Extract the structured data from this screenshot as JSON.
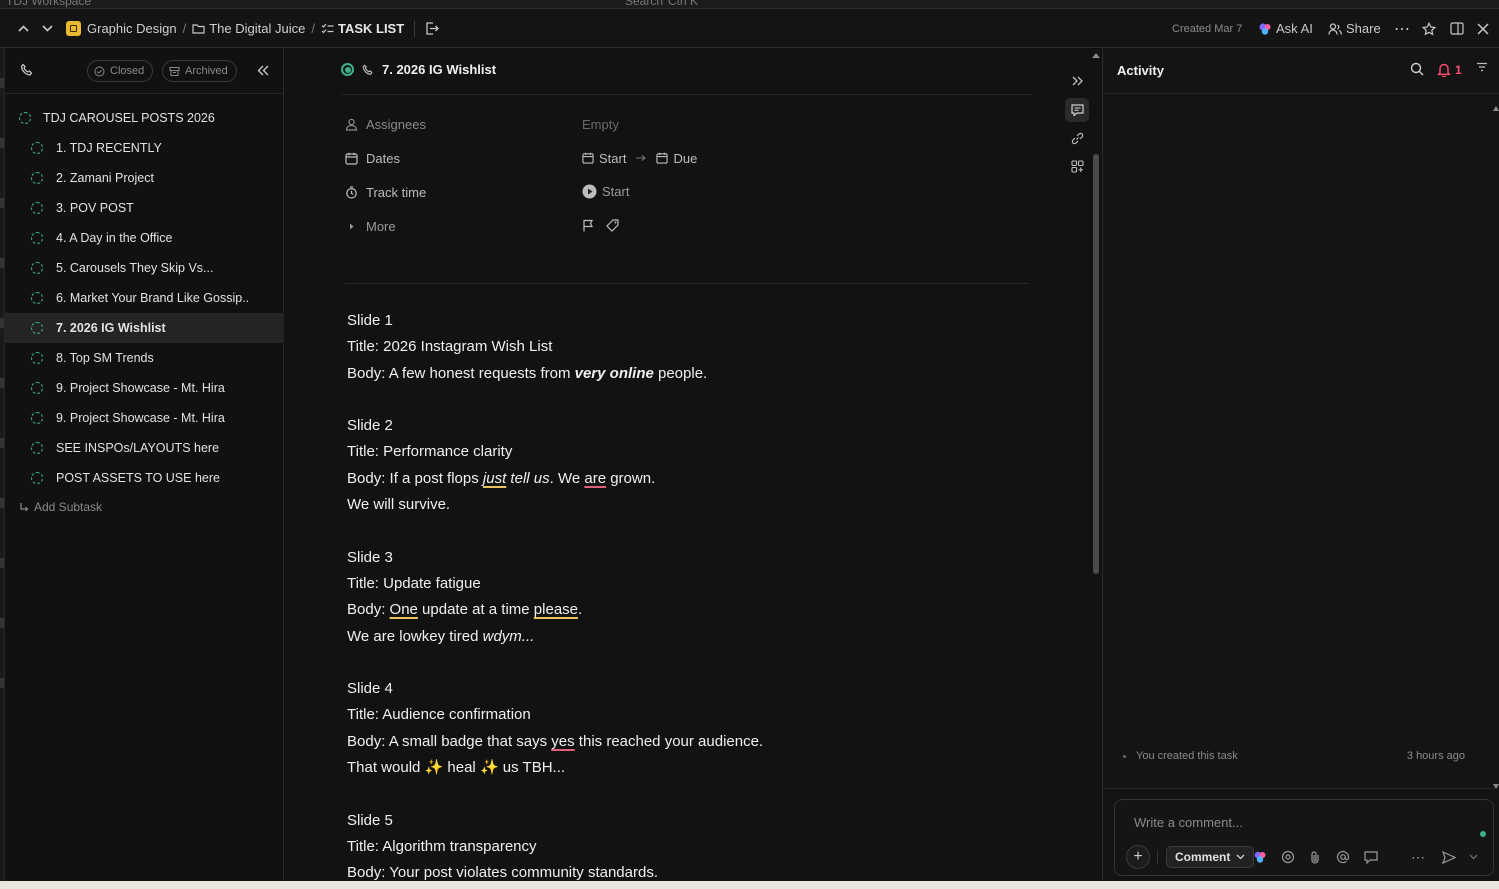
{
  "topstrip": {
    "workspace": "TDJ Workspace",
    "search": "Search",
    "shortcut": "Ctrl K"
  },
  "header": {
    "breadcrumb": [
      "Graphic Design",
      "The Digital Juice",
      "TASK LIST"
    ],
    "created": "Created Mar 7",
    "ask_ai": "Ask AI",
    "share": "Share"
  },
  "left_panel": {
    "filters": {
      "closed": "Closed",
      "archived": "Archived"
    },
    "parent_task": "TDJ CAROUSEL POSTS 2026",
    "subtasks": [
      {
        "label": "1. TDJ RECENTLY"
      },
      {
        "label": "2. Zamani Project"
      },
      {
        "label": "3. POV POST"
      },
      {
        "label": "4. A Day in the Office"
      },
      {
        "label": "5. Carousels They Skip Vs..."
      },
      {
        "label": "6. Market Your Brand Like Gossip.."
      },
      {
        "label": "7. 2026 IG Wishlist"
      },
      {
        "label": "8. Top SM Trends"
      },
      {
        "label": "9. Project Showcase - Mt. Hira"
      },
      {
        "label": "9. Project Showcase - Mt. Hira"
      },
      {
        "label": "SEE INSPOs/LAYOUTS here"
      },
      {
        "label": "POST ASSETS TO USE here"
      }
    ],
    "active_index": 6,
    "add_subtask": "Add Subtask"
  },
  "task": {
    "title": "7. 2026 IG Wishlist",
    "props": {
      "assignees_label": "Assignees",
      "assignees_value": "Empty",
      "dates_label": "Dates",
      "start": "Start",
      "due": "Due",
      "track_label": "Track time",
      "track_start": "Start",
      "more_label": "More"
    },
    "doc": {
      "s1_h": "Slide 1",
      "s1_t": "Title: 2026 Instagram Wish List",
      "s1_b1": "Body: A few honest requests from ",
      "s1_b2": "very online",
      "s1_b3": " people.",
      "s2_h": "Slide 2",
      "s2_t": "Title: Performance clarity",
      "s2_b1": "Body: If a post flops ",
      "s2_b2": "just",
      "s2_b3": " tell us",
      "s2_b4": ". We ",
      "s2_b5": "are",
      "s2_b6": " grown.",
      "s2_b7": "We will survive.",
      "s3_h": "Slide 3",
      "s3_t": "Title: Update fatigue",
      "s3_b1": "Body: ",
      "s3_b2": "One",
      "s3_b3": " update at a time ",
      "s3_b4": "please",
      "s3_b5": ".",
      "s3_b6": "We are lowkey tired ",
      "s3_b7": "wdym...",
      "s4_h": "Slide 4",
      "s4_t": "Title: Audience confirmation",
      "s4_b1": "Body: A small badge that says ",
      "s4_b2": "yes",
      "s4_b3": " this reached your audience.",
      "s4_b4": "That would ",
      "s4_b5": "✨",
      "s4_b6": " heal ",
      "s4_b7": "✨",
      "s4_b8": " us TBH...",
      "s5_h": "Slide 5",
      "s5_t": "Title: Algorithm transparency",
      "s5_b": "Body: Your post violates community standards."
    }
  },
  "activity": {
    "title": "Activity",
    "notif_count": "1",
    "entry_text": "You created this task",
    "entry_time": "3 hours ago",
    "comment_placeholder": "Write a comment...",
    "comment_button": "Comment"
  },
  "colors": {
    "accent_green": "#3fb08a",
    "notif_red": "#ff4d6d",
    "underline_yellow": "#e8c25a",
    "underline_pink": "#e0607a"
  }
}
